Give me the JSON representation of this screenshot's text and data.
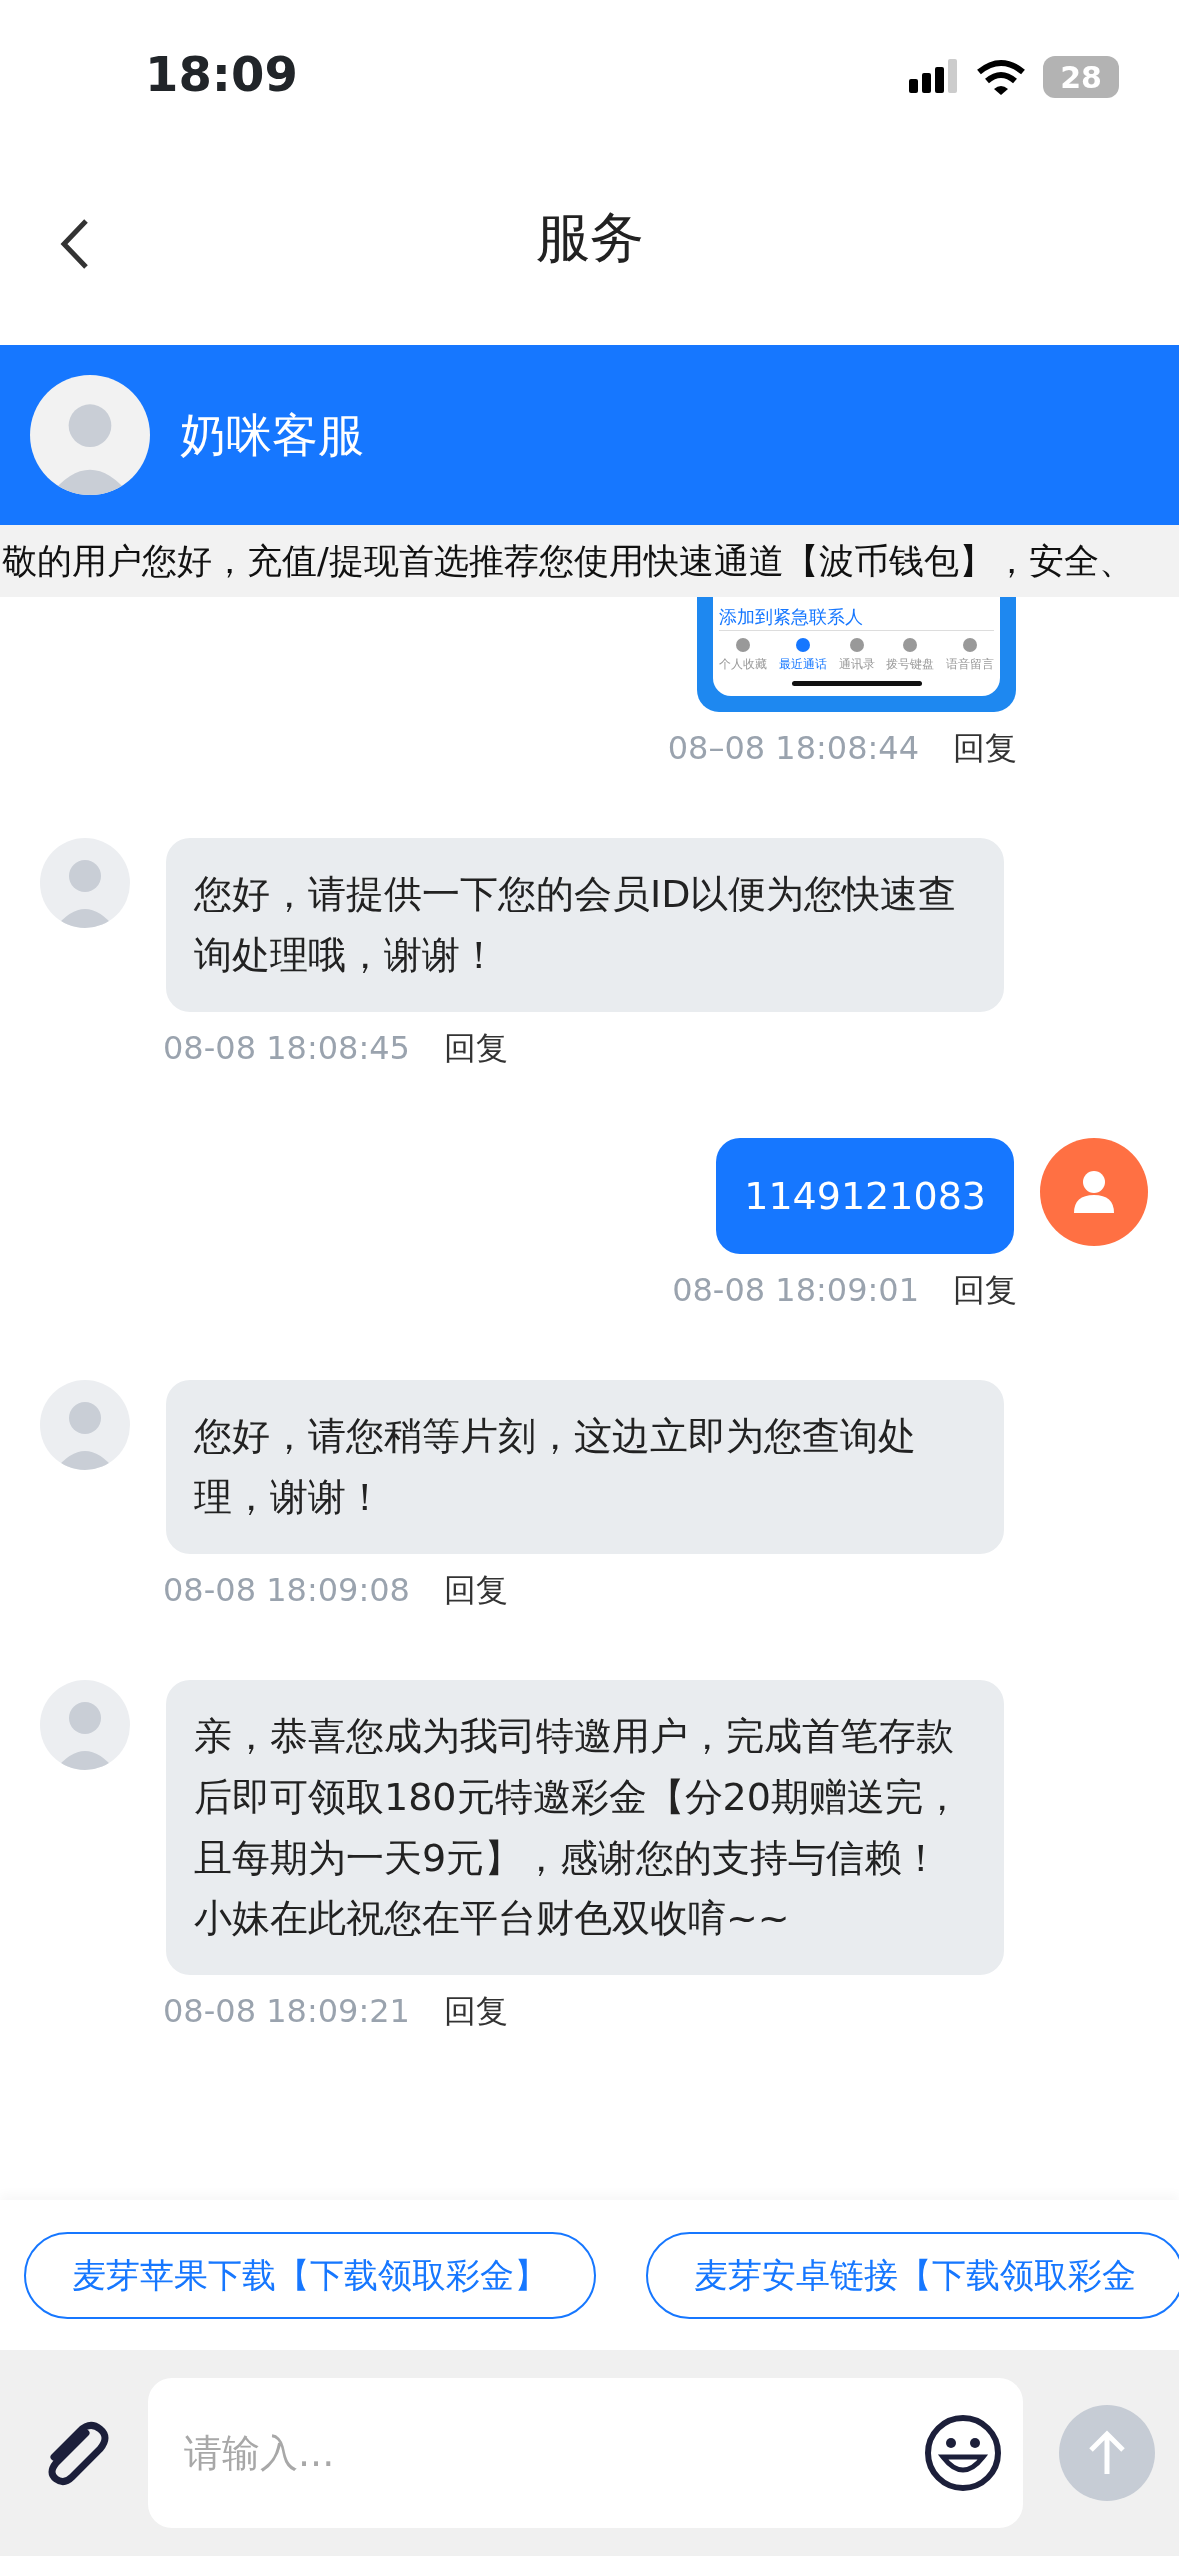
{
  "status_bar": {
    "time": "18:09",
    "battery": "28"
  },
  "nav": {
    "title": "服务"
  },
  "header": {
    "name": "奶咪客服"
  },
  "notice": "敬的用户您好，充值/提现首选推荐您使用快速通道【波币钱包】，安全、",
  "messages": [
    {
      "kind": "user_image",
      "image_texts": {
        "link": "添加到紧急联系人",
        "tabs": [
          {
            "label": "个人收藏",
            "selected": false
          },
          {
            "label": "最近通话",
            "selected": true
          },
          {
            "label": "通讯录",
            "selected": false
          },
          {
            "label": "拨号键盘",
            "selected": false
          },
          {
            "label": "语音留言",
            "selected": false
          }
        ]
      },
      "time": "08–08 18:08:44",
      "reply": "回复"
    },
    {
      "kind": "agent_text",
      "text": "您好，请提供一下您的会员ID以便为您快速查询处理哦，谢谢！",
      "time": "08-08 18:08:45",
      "reply": "回复"
    },
    {
      "kind": "user_text",
      "text": "1149121083",
      "time": "08-08 18:09:01",
      "reply": "回复"
    },
    {
      "kind": "agent_text",
      "text": "您好，请您稍等片刻，这边立即为您查询处理，谢谢！",
      "time": "08-08 18:09:08",
      "reply": "回复"
    },
    {
      "kind": "agent_text",
      "text": "亲，恭喜您成为我司特邀用户，完成首笔存款后即可领取180元特邀彩金【分20期赠送完，且每期为一天9元】，感谢您的支持与信赖！小妹在此祝您在平台财色双收唷~~",
      "time": "08-08 18:09:21",
      "reply": "回复"
    }
  ],
  "quick_replies": [
    "麦芽苹果下载【下载领取彩金】",
    "麦芽安卓链接【下载领取彩金"
  ],
  "input": {
    "placeholder": "请输入..."
  }
}
